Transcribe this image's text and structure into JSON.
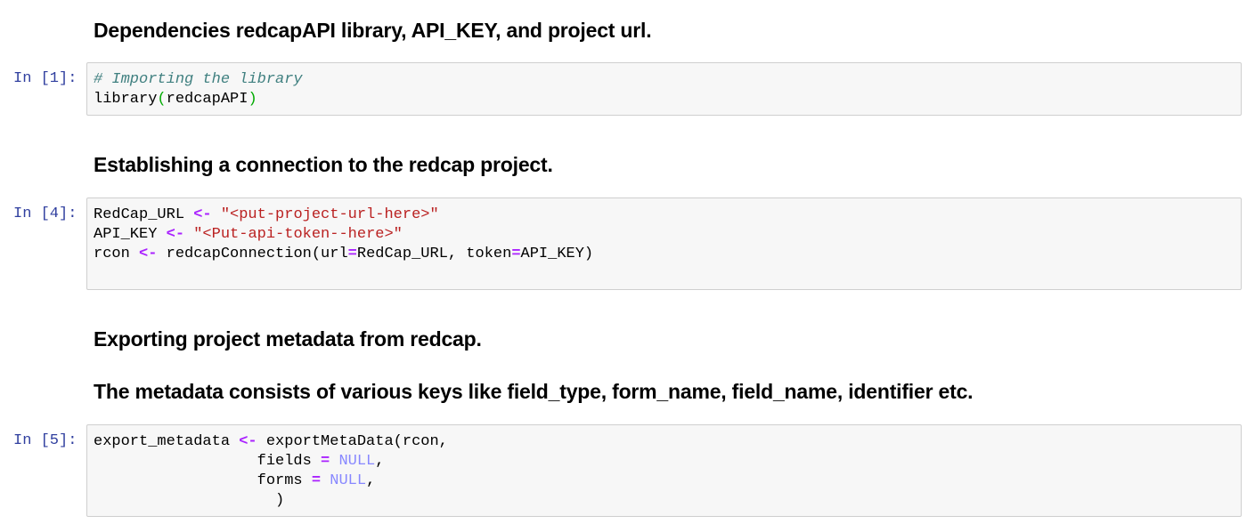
{
  "cells": {
    "md1": {
      "text": "Dependencies redcapAPI library, API_KEY, and project url."
    },
    "code1": {
      "prompt": "In [1]:",
      "comment": "# Importing the library",
      "fn": "library",
      "open_paren": "(",
      "arg": "redcapAPI",
      "close_paren": ")"
    },
    "md2": {
      "text": "Establishing a connection to the redcap project."
    },
    "code2": {
      "prompt": "In [4]:",
      "line1_var": "RedCap_URL ",
      "assign_op": "<-",
      "line1_val": "\"<put-project-url-here>\"",
      "line2_var": "API_KEY ",
      "line2_val": "\"<Put-api-token--here>\"",
      "line3_var": "rcon ",
      "line3_call": " redcapConnection(url",
      "eq_op": "=",
      "line3_arg1": "RedCap_URL, token",
      "line3_arg2": "API_KEY)"
    },
    "md3": {
      "text": "Exporting project metadata from redcap."
    },
    "md4": {
      "text": "The metadata consists of various keys like field_type, form_name, field_name, identifier etc."
    },
    "code3": {
      "prompt": "In [5]:",
      "line1_var": "export_metadata ",
      "assign_op": "<-",
      "line1_call": " exportMetaData(rcon,",
      "line2_param": "                  fields ",
      "eq_op": "=",
      "null_val": "NULL",
      "comma": ",",
      "line3_param": "                  forms ",
      "line4": "                    )"
    }
  },
  "colors": {
    "prompt": "#303f9f",
    "comment": "#408080",
    "operator": "#aa22ff",
    "string": "#ba2121",
    "null_literal": "#8888ff",
    "paren": "#00aa00",
    "cell_background": "#f7f7f7",
    "cell_border": "#cfcfcf"
  }
}
